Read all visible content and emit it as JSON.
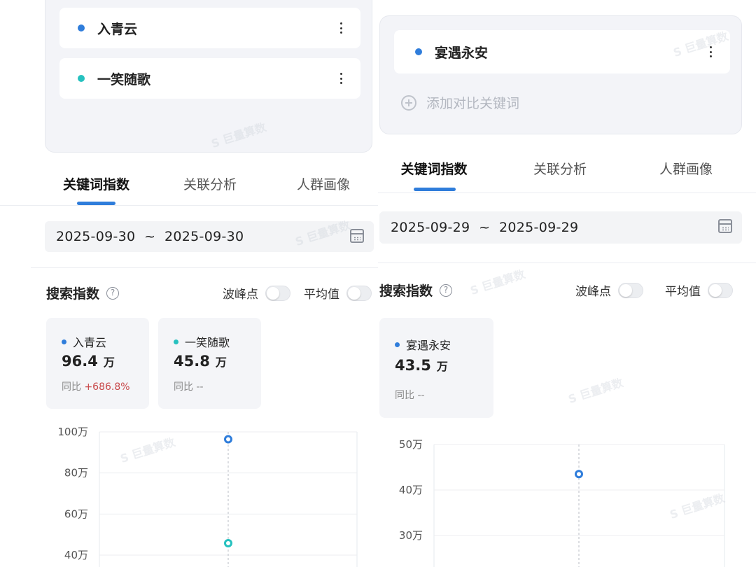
{
  "left": {
    "keywords": [
      {
        "label": "入青云",
        "color": "#2f7ddb"
      },
      {
        "label": "一笑随歌",
        "color": "#26c1bf"
      }
    ],
    "tabs": [
      "关键词指数",
      "关联分析",
      "人群画像"
    ],
    "date_range": "2025-09-30  ~  2025-09-30",
    "section_title": "搜索指数",
    "toggles": {
      "peak": "波峰点",
      "average": "平均值"
    },
    "metrics": [
      {
        "name": "入青云",
        "color": "#2f7ddb",
        "value": "96.4",
        "unit": "万",
        "yoy_label": "同比",
        "yoy_value": "+686.8%"
      },
      {
        "name": "一笑随歌",
        "color": "#26c1bf",
        "value": "45.8",
        "unit": "万",
        "yoy_label": "同比",
        "yoy_value": "--"
      }
    ]
  },
  "right": {
    "keywords": [
      {
        "label": "宴遇永安",
        "color": "#2f7ddb"
      }
    ],
    "add_keyword": "添加对比关键词",
    "tabs": [
      "关键词指数",
      "关联分析",
      "人群画像"
    ],
    "date_range": "2025-09-29  ~  2025-09-29",
    "section_title": "搜索指数",
    "toggles": {
      "peak": "波峰点",
      "average": "平均值"
    },
    "metrics": [
      {
        "name": "宴遇永安",
        "color": "#2f7ddb",
        "value": "43.5",
        "unit": "万",
        "yoy_label": "同比",
        "yoy_value": "--"
      }
    ]
  },
  "chart_data": [
    {
      "type": "scatter",
      "title": "",
      "ytick_labels": [
        "40万",
        "60万",
        "80万",
        "100万"
      ],
      "yticks": [
        40,
        60,
        80,
        100
      ],
      "ylim": [
        40,
        100
      ],
      "unit": "万",
      "x": [
        "2025-09-30"
      ],
      "series": [
        {
          "name": "入青云",
          "color": "#2f7ddb",
          "values": [
            96.4
          ]
        },
        {
          "name": "一笑随歌",
          "color": "#26c1bf",
          "values": [
            45.8
          ]
        }
      ],
      "grid": true
    },
    {
      "type": "scatter",
      "title": "",
      "ytick_labels": [
        "30万",
        "40万",
        "50万"
      ],
      "yticks": [
        30,
        40,
        50
      ],
      "ylim": [
        30,
        50
      ],
      "unit": "万",
      "x": [
        "2025-09-29"
      ],
      "series": [
        {
          "name": "宴遇永安",
          "color": "#2f7ddb",
          "values": [
            43.5
          ]
        }
      ],
      "grid": true
    }
  ]
}
